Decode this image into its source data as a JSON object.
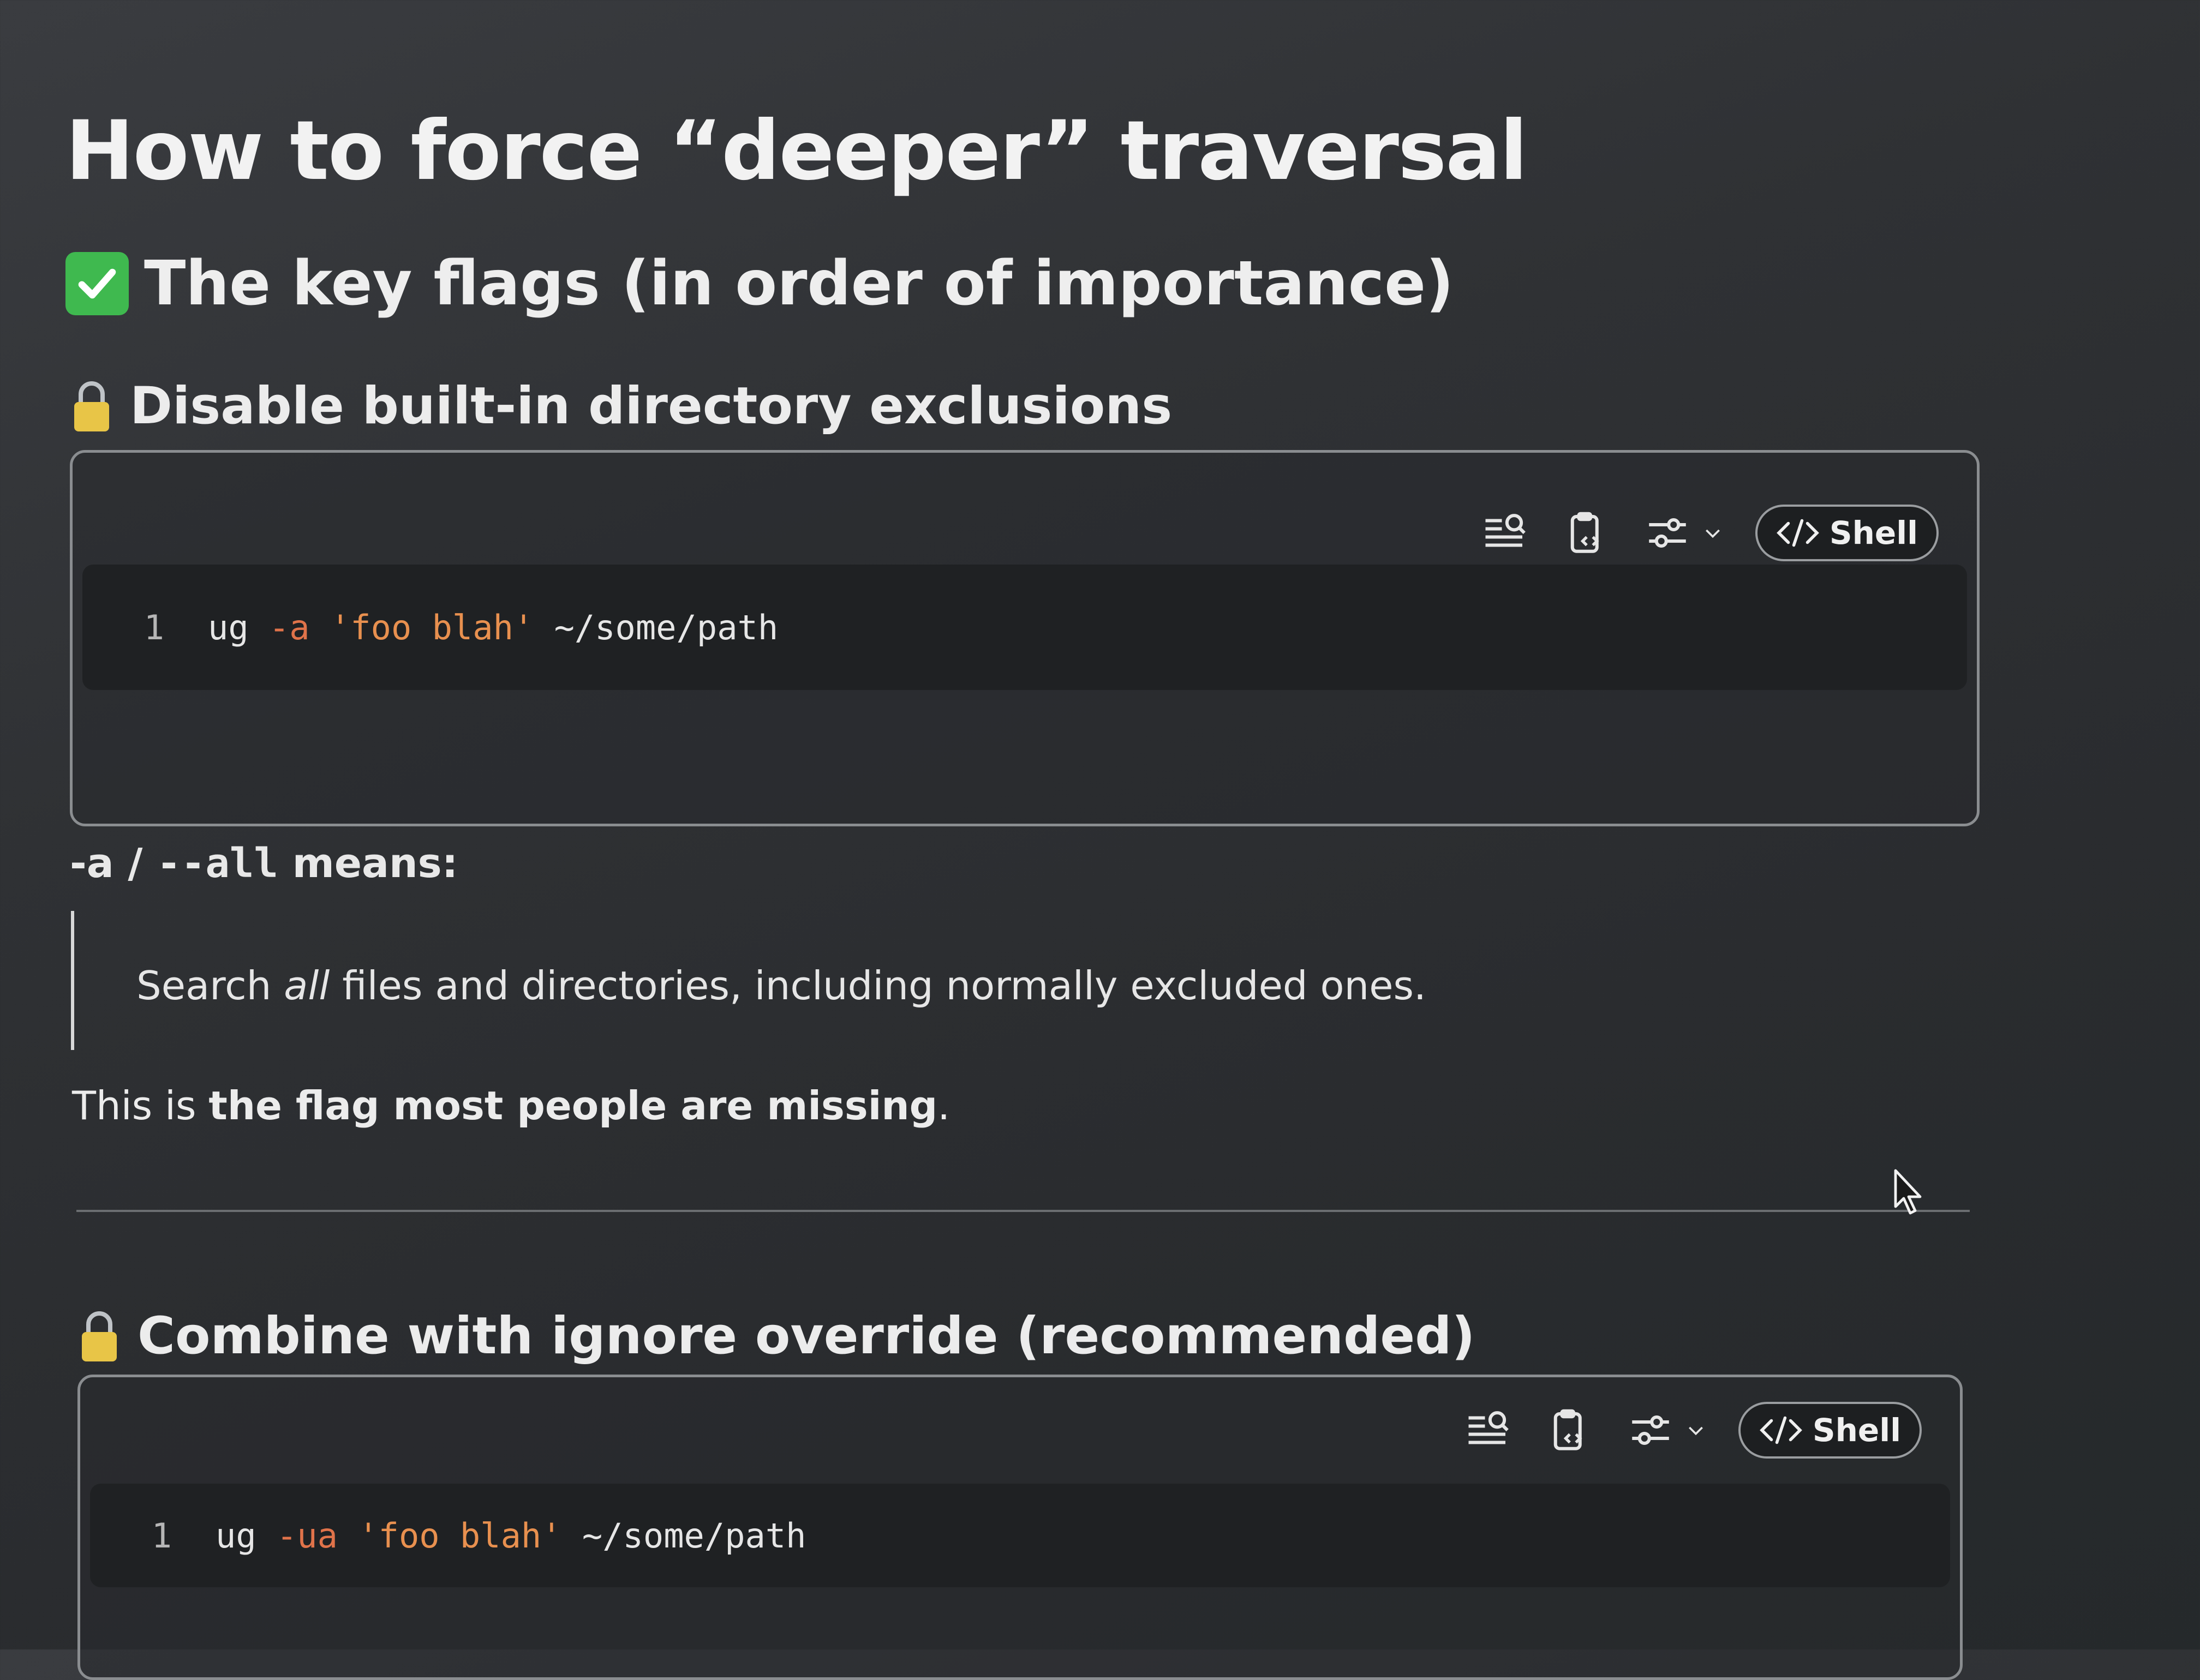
{
  "heading": "How to force “deeper” traversal",
  "subheading": "The key flags (in order of importance)",
  "section1": {
    "title": "Disable built-in directory exclusions",
    "code": {
      "line_number": "1",
      "cmd": "ug",
      "flag": "-a",
      "arg": "'foo blah'",
      "path": "~/some/path"
    },
    "language": "Shell",
    "means": {
      "flag_short": "-a",
      "sep": " / ",
      "flag_long": "--all",
      "suffix": " means:"
    },
    "quote": {
      "before": "Search ",
      "emphasis": "all",
      "after": " files and directories, including normally excluded ones."
    },
    "note": {
      "before": "This is ",
      "bold": "the flag most people are missing",
      "after": "."
    }
  },
  "section2": {
    "title": "Combine with ignore override (recommended)",
    "code": {
      "line_number": "1",
      "cmd": "ug",
      "flag": "-ua",
      "arg": "'foo blah'",
      "path": "~/some/path"
    },
    "language": "Shell"
  },
  "colors": {
    "check_badge": "#3fb94f",
    "lock": "#e8c547",
    "flag_token": "#e0734a",
    "string_token": "#e8904f"
  },
  "icons": [
    "check-icon",
    "lock-icon",
    "search-lines-icon",
    "copy-code-icon",
    "settings-sliders-icon",
    "chevron-down-icon",
    "code-icon",
    "mouse-cursor-icon"
  ]
}
